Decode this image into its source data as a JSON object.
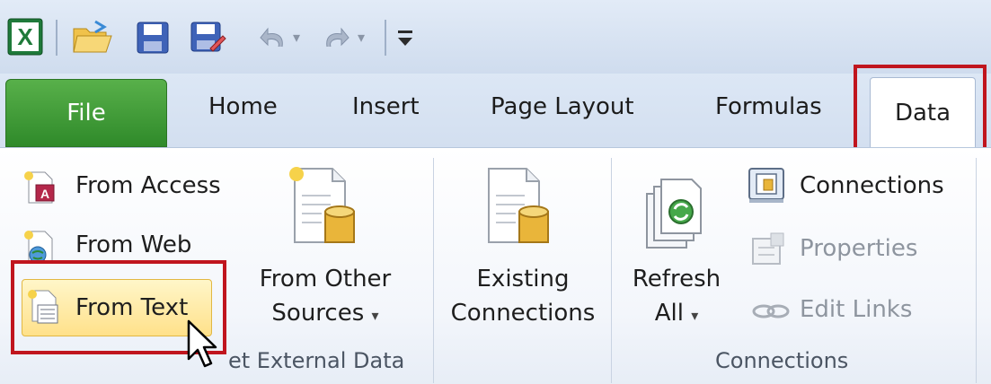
{
  "colors": {
    "file_tab": "#3a9a33",
    "highlight_box": "#c0151e",
    "ribbon_bg": "#ffffff",
    "qat_bg": "#dce7f5"
  },
  "quick_access": {
    "icons": [
      "excel-icon",
      "open-folder-icon",
      "save-icon",
      "save-as-icon",
      "undo-icon",
      "redo-icon",
      "customize-qat-icon"
    ],
    "caret": "▾"
  },
  "tabs": {
    "file": "File",
    "home": "Home",
    "insert": "Insert",
    "page_layout": "Page Layout",
    "formulas": "Formulas",
    "data": "Data"
  },
  "get_external_data": {
    "from_access": "From Access",
    "from_web": "From Web",
    "from_text": "From Text",
    "from_other_line1": "From Other",
    "from_other_line2": "Sources",
    "existing_line1": "Existing",
    "existing_line2": "Connections",
    "group_label_partial": "et External Data"
  },
  "connections": {
    "refresh_line1": "Refresh",
    "refresh_line2": "All",
    "connections": "Connections",
    "properties": "Properties",
    "edit_links": "Edit Links",
    "group_label": "Connections"
  },
  "dropdown_caret": "▾"
}
